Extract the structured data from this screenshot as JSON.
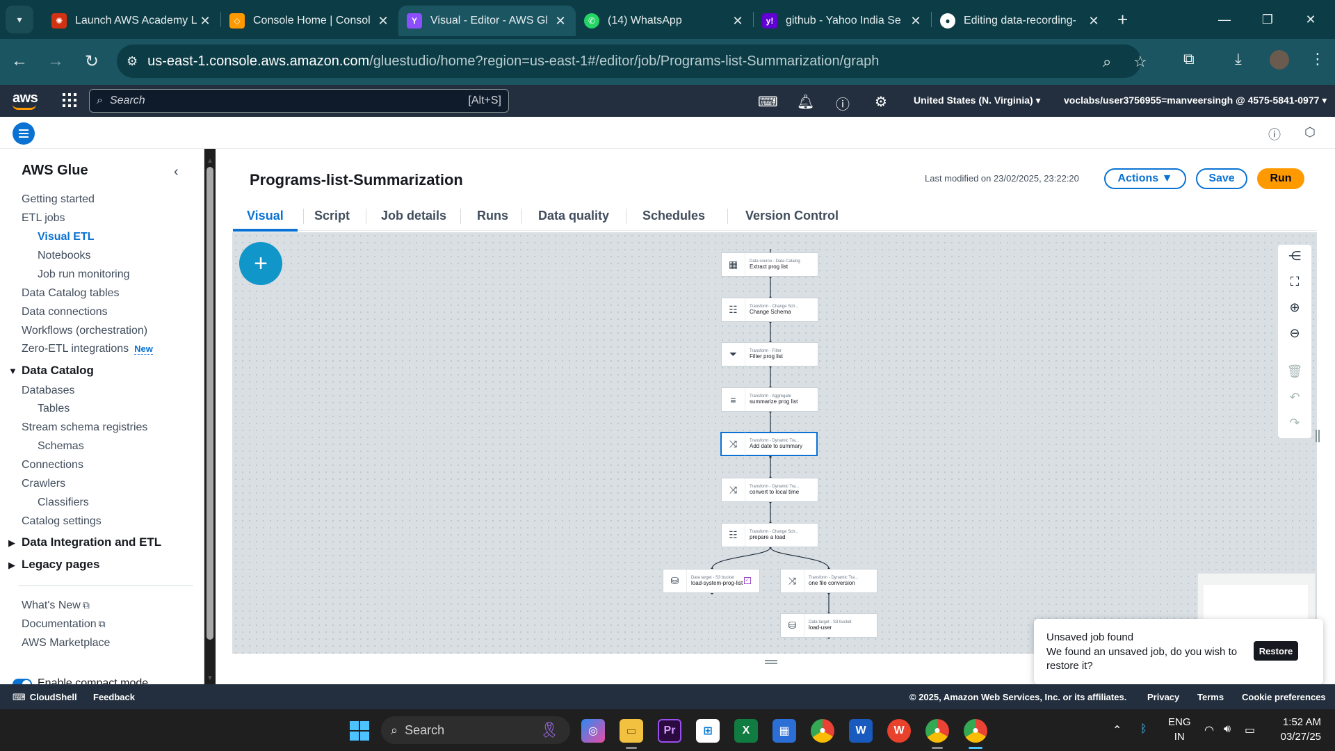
{
  "browser": {
    "tabs": [
      {
        "title": "Launch AWS Academy L",
        "favicon": "aws-academy-icon",
        "color": "#d13212"
      },
      {
        "title": "Console Home | Consol",
        "favicon": "aws-console-icon",
        "color": "#ff9900"
      },
      {
        "title": "Visual - Editor - AWS Gl",
        "favicon": "aws-glue-icon",
        "color": "#8c4fff",
        "active": true
      },
      {
        "title": "(14) WhatsApp",
        "favicon": "whatsapp-icon",
        "color": "#25d366"
      },
      {
        "title": "github - Yahoo India Se",
        "favicon": "yahoo-icon",
        "color": "#6001d2"
      },
      {
        "title": "Editing data-recording-",
        "favicon": "github-icon",
        "color": "#ffffff"
      }
    ],
    "url_host": "us-east-1.console.aws.amazon.com",
    "url_path": "/gluestudio/home?region=us-east-1#/editor/job/Programs-list-Summarization/graph"
  },
  "aws_nav": {
    "logo": "aws",
    "search_placeholder": "Search",
    "search_shortcut": "[Alt+S]",
    "region": "United States (N. Virginia) ▾",
    "account": "voclabs/user3756955=manveersingh @ 4575-5841-0977 ▾"
  },
  "sidebar": {
    "title": "AWS Glue",
    "items": {
      "getting_started": "Getting started",
      "etl_jobs": "ETL jobs",
      "visual_etl": "Visual ETL",
      "notebooks": "Notebooks",
      "job_run_monitoring": "Job run monitoring",
      "data_catalog_tables": "Data Catalog tables",
      "data_connections": "Data connections",
      "workflows": "Workflows (orchestration)",
      "zero_etl": "Zero-ETL integrations",
      "new_badge": "New",
      "data_catalog": "Data Catalog",
      "databases": "Databases",
      "tables": "Tables",
      "stream_schema": "Stream schema registries",
      "schemas": "Schemas",
      "connections": "Connections",
      "crawlers": "Crawlers",
      "classifiers": "Classifiers",
      "catalog_settings": "Catalog settings",
      "data_integration": "Data Integration and ETL",
      "legacy_pages": "Legacy pages",
      "whats_new": "What's New",
      "documentation": "Documentation",
      "marketplace": "AWS Marketplace",
      "compact_mode": "Enable compact mode"
    }
  },
  "job": {
    "title": "Programs-list-Summarization",
    "last_modified": "Last modified on 23/02/2025, 23:22:20",
    "actions_label": "Actions ▼",
    "save_label": "Save",
    "run_label": "Run"
  },
  "tabs": {
    "visual": "Visual",
    "script": "Script",
    "job_details": "Job details",
    "runs": "Runs",
    "data_quality": "Data quality",
    "schedules": "Schedules",
    "version_control": "Version Control"
  },
  "graph": {
    "nodes": [
      {
        "type": "Data source - Data Catalog",
        "label": "Extract prog list",
        "icon": "catalog-icon"
      },
      {
        "type": "Transform - Change Sch...",
        "label": "Change Schema",
        "icon": "schema-icon"
      },
      {
        "type": "Transform - Filter",
        "label": "Filter prog list",
        "icon": "filter-icon"
      },
      {
        "type": "Transform - Aggregate",
        "label": "summarize prog list",
        "icon": "aggregate-icon"
      },
      {
        "type": "Transform - Dynamic Tra...",
        "label": "Add date to summary",
        "icon": "shuffle-icon",
        "selected": true
      },
      {
        "type": "Transform - Dynamic Tra...",
        "label": "convert to local time",
        "icon": "shuffle-icon"
      },
      {
        "type": "Transform - Change Sch...",
        "label": "prepare a load",
        "icon": "schema-icon"
      },
      {
        "type": "Data target - S3 bucket",
        "label": "load-system-prog-list",
        "icon": "bucket-icon"
      },
      {
        "type": "Transform - Dynamic Tra...",
        "label": "one file conversion",
        "icon": "shuffle-icon"
      },
      {
        "type": "Data target - S3 bucket",
        "label": "load-user",
        "icon": "bucket-icon"
      }
    ]
  },
  "notification": {
    "title": "Unsaved job found",
    "body": "We found an unsaved job, do you wish to restore it?",
    "restore_label": "Restore"
  },
  "footer": {
    "cloudshell": "CloudShell",
    "feedback": "Feedback",
    "copyright": "© 2025, Amazon Web Services, Inc. or its affiliates.",
    "privacy": "Privacy",
    "terms": "Terms",
    "cookie": "Cookie preferences"
  },
  "taskbar": {
    "search": "Search",
    "lang_top": "ENG",
    "lang_bottom": "IN",
    "time": "1:52 AM",
    "date": "03/27/25"
  }
}
